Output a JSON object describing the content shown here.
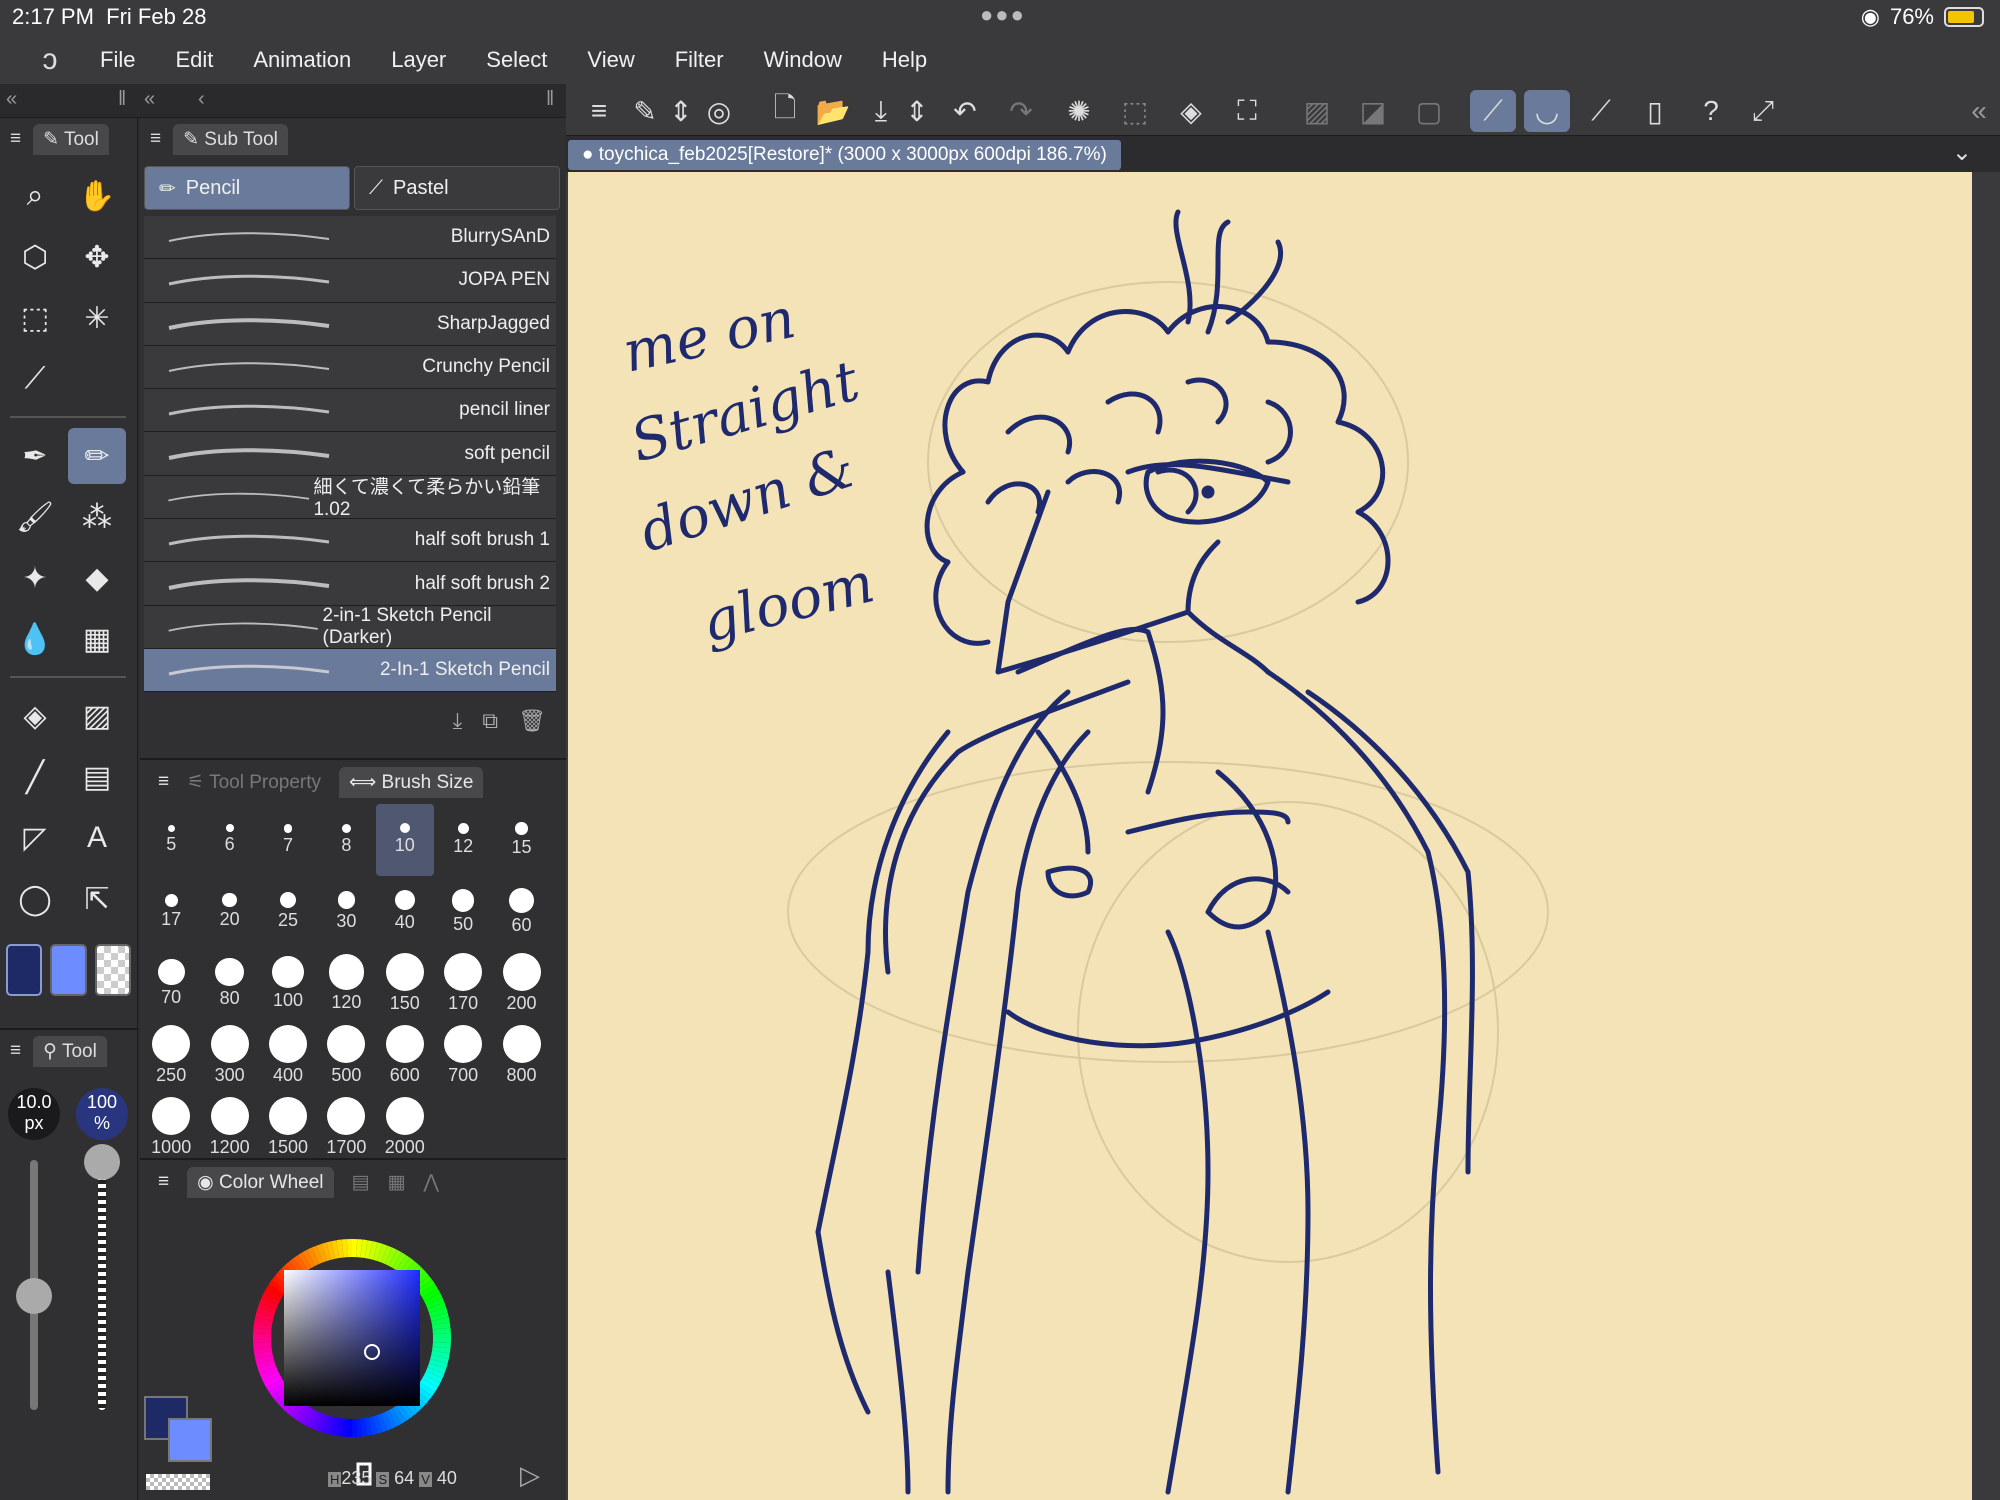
{
  "status": {
    "time": "2:17 PM",
    "date": "Fri Feb 28",
    "battery": "76%"
  },
  "menu": [
    "File",
    "Edit",
    "Animation",
    "Layer",
    "Select",
    "View",
    "Filter",
    "Window",
    "Help"
  ],
  "tool_panel": {
    "tab": "Tool"
  },
  "tool_size": {
    "tab": "Tool",
    "size": "10.0",
    "size_unit": "px",
    "opacity": "100",
    "opacity_unit": "%"
  },
  "sub_tool": {
    "tab": "Sub Tool",
    "groups": [
      "Pencil",
      "Pastel"
    ],
    "brushes": [
      "BlurrySAnD",
      "JOPA PEN",
      "SharpJagged",
      "Crunchy Pencil",
      "pencil liner",
      "soft pencil",
      "細くて濃くて柔らかい鉛筆 1.02",
      "half soft brush 1",
      "half soft brush 2",
      "2-in-1 Sketch Pencil (Darker)",
      "2-In-1 Sketch Pencil"
    ],
    "selected_brush": "2-In-1 Sketch Pencil"
  },
  "brush_size_panel": {
    "tabs": [
      "Tool Property",
      "Brush Size"
    ],
    "sizes": [
      "5",
      "6",
      "7",
      "8",
      "10",
      "12",
      "15",
      "17",
      "20",
      "25",
      "30",
      "40",
      "50",
      "60",
      "70",
      "80",
      "100",
      "120",
      "150",
      "170",
      "200",
      "250",
      "300",
      "400",
      "500",
      "600",
      "700",
      "800",
      "1000",
      "1200",
      "1500",
      "1700",
      "2000"
    ],
    "selected": "10"
  },
  "color_panel": {
    "tab": "Color Wheel",
    "h_label": "H",
    "h": "235",
    "s_label": "S",
    "s": "64",
    "v_label": "V",
    "v": "40"
  },
  "colors": {
    "main": "#1e2a66",
    "sub": "#6d8cff",
    "canvas": "#f3e3b6",
    "accent": "#6a7a9a",
    "ink": "#1f2a6e"
  },
  "document": {
    "tab_title": "toychica_feb2025[Restore]* (3000 x 3000px 600dpi 186.7%)"
  },
  "canvas_text": {
    "line1": "me on",
    "line2": "Straight",
    "line3": "down &",
    "line4": "gloom"
  }
}
